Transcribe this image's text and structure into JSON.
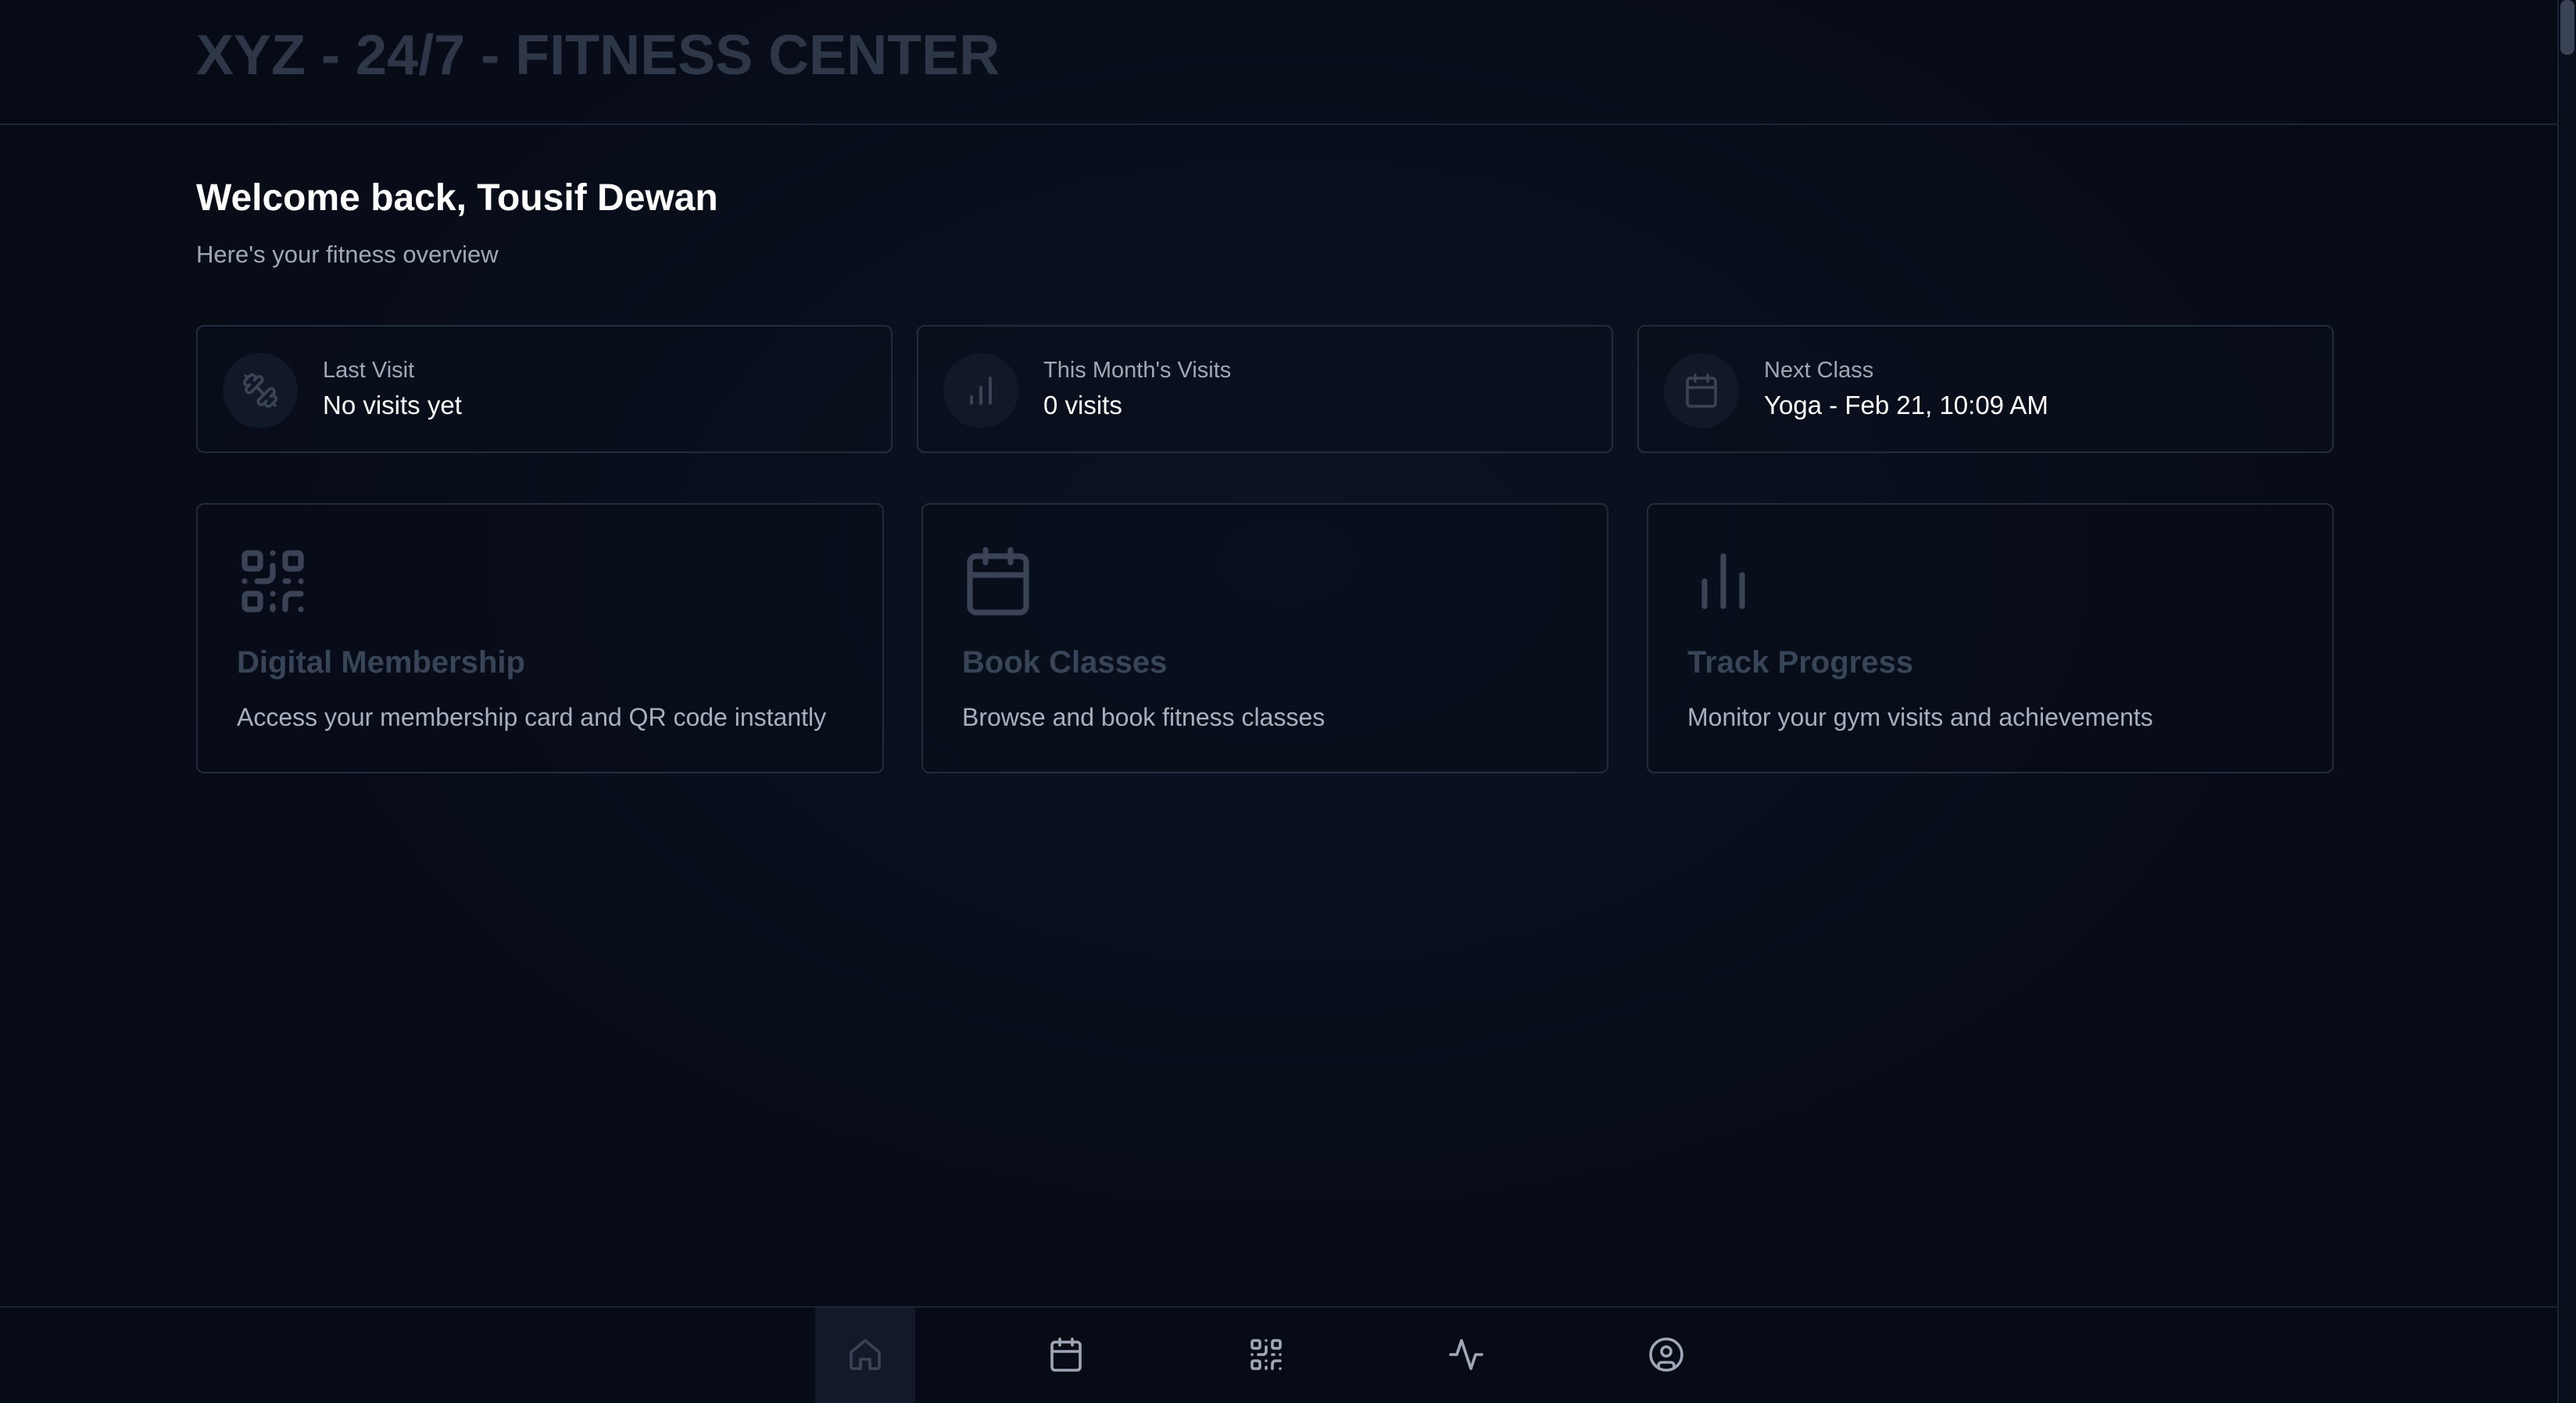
{
  "header": {
    "app_title": "XYZ - 24/7 - FITNESS CENTER"
  },
  "welcome": {
    "title": "Welcome back, Tousif Dewan",
    "subtitle": "Here's your fitness overview"
  },
  "stats": [
    {
      "label": "Last Visit",
      "value": "No visits yet",
      "icon": "dumbbell-icon"
    },
    {
      "label": "This Month's Visits",
      "value": "0 visits",
      "icon": "bar-chart-icon"
    },
    {
      "label": "Next Class",
      "value": "Yoga - Feb 21, 10:09 AM",
      "icon": "calendar-icon"
    }
  ],
  "features": [
    {
      "title": "Digital Membership",
      "description": "Access your membership card and QR code instantly",
      "icon": "qr-code-icon"
    },
    {
      "title": "Book Classes",
      "description": "Browse and book fitness classes",
      "icon": "calendar-icon"
    },
    {
      "title": "Track Progress",
      "description": "Monitor your gym visits and achievements",
      "icon": "bar-chart-icon"
    }
  ],
  "bottom_nav": {
    "items": [
      {
        "name": "home",
        "icon": "home-icon",
        "active": true
      },
      {
        "name": "classes",
        "icon": "calendar-icon",
        "active": false
      },
      {
        "name": "membership",
        "icon": "qr-code-icon",
        "active": false
      },
      {
        "name": "activity",
        "icon": "activity-icon",
        "active": false
      },
      {
        "name": "profile",
        "icon": "user-circle-icon",
        "active": false
      }
    ]
  },
  "colors": {
    "background": "#070b16",
    "card_border": "#232c3d",
    "title_muted": "#2d3748",
    "text_secondary": "#a0a8b8",
    "icon_muted": "#3a4456"
  }
}
